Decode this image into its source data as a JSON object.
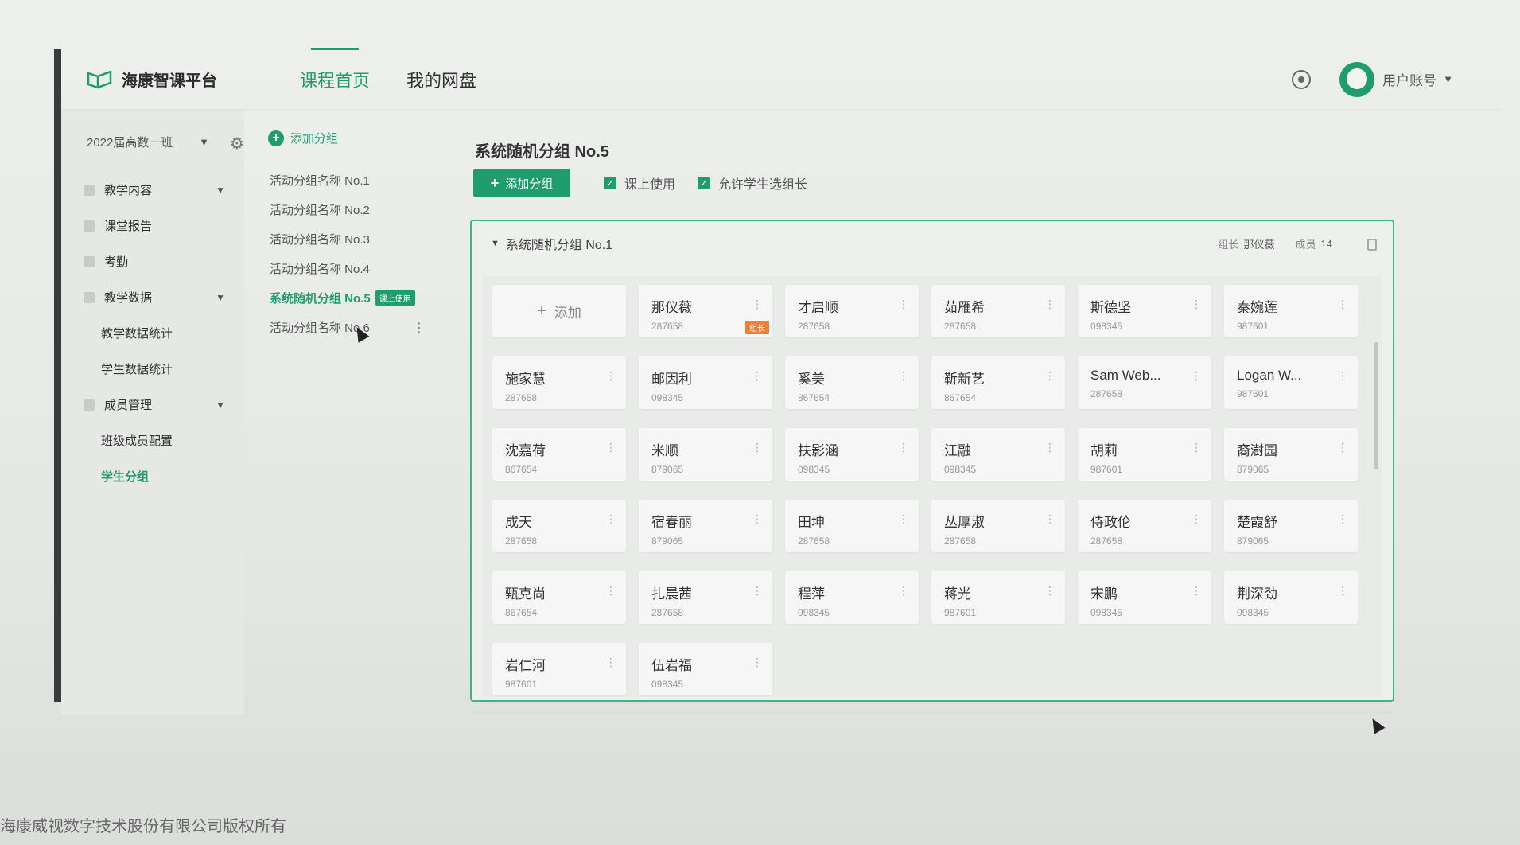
{
  "header": {
    "logo_text": "海康智课平台",
    "tabs": [
      {
        "label": "课程首页",
        "active": true
      },
      {
        "label": "我的网盘",
        "active": false
      }
    ],
    "account_label": "用户账号"
  },
  "sidebar": {
    "class_select": "2022届高数一班",
    "items": [
      {
        "label": "教学内容",
        "has_caret": true
      },
      {
        "label": "课堂报告"
      },
      {
        "label": "考勤"
      },
      {
        "label": "教学数据",
        "has_caret": true
      },
      {
        "label": "教学数据统计",
        "sub": true
      },
      {
        "label": "学生数据统计",
        "sub": true
      },
      {
        "label": "成员管理",
        "has_caret": true
      },
      {
        "label": "班级成员配置",
        "sub": true
      },
      {
        "label": "学生分组",
        "sub": true,
        "active": true
      }
    ]
  },
  "group_list": {
    "add_label": "添加分组",
    "items": [
      {
        "label": "活动分组名称 No.1"
      },
      {
        "label": "活动分组名称 No.2"
      },
      {
        "label": "活动分组名称 No.3"
      },
      {
        "label": "活动分组名称 No.4"
      },
      {
        "label": "系统随机分组 No.5",
        "active": true,
        "badge": "课上使用"
      },
      {
        "label": "活动分组名称 No.6"
      }
    ]
  },
  "main": {
    "title": "系统随机分组 No.5",
    "add_button": "添加分组",
    "checks": [
      "课上使用",
      "允许学生选组长"
    ],
    "panel": {
      "title": "系统随机分组 No.1",
      "leader_label": "组长",
      "leader_value": "那仪薇",
      "members_label": "成员",
      "members_value": "14",
      "add_card_label": "添加",
      "leader_tag": "组长",
      "members": [
        {
          "name": "那仪薇",
          "id": "287658",
          "leader": true
        },
        {
          "name": "才启顺",
          "id": "287658"
        },
        {
          "name": "茹雁希",
          "id": "287658"
        },
        {
          "name": "斯德坚",
          "id": "098345"
        },
        {
          "name": "秦婉莲",
          "id": "987601"
        },
        {
          "name": "施家慧",
          "id": "287658"
        },
        {
          "name": "邮因利",
          "id": "098345"
        },
        {
          "name": "奚美",
          "id": "867654"
        },
        {
          "name": "靳新艺",
          "id": "867654"
        },
        {
          "name": "Sam Web...",
          "id": "287658"
        },
        {
          "name": "Logan W...",
          "id": "987601"
        },
        {
          "name": "沈嘉荷",
          "id": "867654"
        },
        {
          "name": "米顺",
          "id": "879065"
        },
        {
          "name": "扶影涵",
          "id": "098345"
        },
        {
          "name": "江融",
          "id": "098345"
        },
        {
          "name": "胡莉",
          "id": "987601"
        },
        {
          "name": "裔澍园",
          "id": "879065"
        },
        {
          "name": "成天",
          "id": "287658"
        },
        {
          "name": "宿春丽",
          "id": "879065"
        },
        {
          "name": "田坤",
          "id": "287658"
        },
        {
          "name": "丛厚淑",
          "id": "287658"
        },
        {
          "name": "侍政伦",
          "id": "287658"
        },
        {
          "name": "楚霞舒",
          "id": "879065"
        },
        {
          "name": "甄克尚",
          "id": "867654"
        },
        {
          "name": "扎晨茜",
          "id": "287658"
        },
        {
          "name": "程萍",
          "id": "098345"
        },
        {
          "name": "蒋光",
          "id": "987601"
        },
        {
          "name": "宋鹏",
          "id": "098345"
        },
        {
          "name": "荆深劲",
          "id": "098345"
        },
        {
          "name": "岩仁河",
          "id": "987601"
        },
        {
          "name": "伍岩福",
          "id": "098345"
        }
      ]
    }
  },
  "footer": {
    "copyright": "海康威视数字技术股份有限公司版权所有"
  },
  "colors": {
    "accent": "#1f9d6f",
    "leader_tag": "#f08030"
  }
}
